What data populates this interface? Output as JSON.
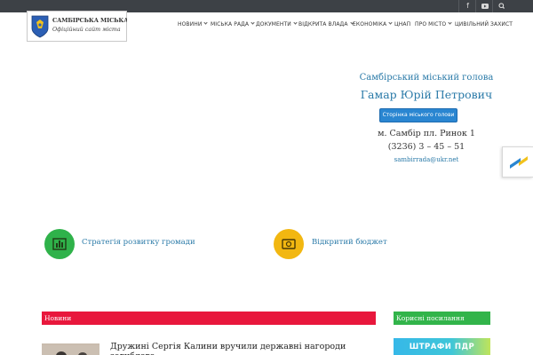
{
  "logo": {
    "title": "САМБІРСЬКА МІСЬКА РАДА",
    "subtitle": "Офіційний сайт міста",
    "crest_color": "#2c5fb4"
  },
  "social": [
    {
      "icon": "facebook-icon",
      "glyph": "f"
    },
    {
      "icon": "youtube-icon",
      "glyph": "▶"
    },
    {
      "icon": "search-icon",
      "glyph": "⌕"
    }
  ],
  "nav": [
    {
      "label": "НОВИНИ",
      "has_dropdown": true
    },
    {
      "label": "МІСЬКА РАДА",
      "has_dropdown": true
    },
    {
      "label": "ДОКУМЕНТИ",
      "has_dropdown": true
    },
    {
      "label": "ВІДКРИТА ВЛАДА",
      "has_dropdown": true
    },
    {
      "label": "ЕКОНОМІКА",
      "has_dropdown": true
    },
    {
      "label": "ЦНАП",
      "has_dropdown": false
    },
    {
      "label": "ПРО МІСТО",
      "has_dropdown": true
    },
    {
      "label": "ЦИВІЛЬНИЙ ЗАХИСТ",
      "has_dropdown": false
    }
  ],
  "mayor": {
    "title": "Самбірський міський голова",
    "name": "Гамар Юрій Петрович",
    "button": "Сторінка міського голови",
    "address": "м. Самбір пл. Ринок 1",
    "phone": "(3236) 3 – 45 – 51",
    "email": "sambirrada@ukr.net"
  },
  "features": [
    {
      "label": "Стратегія розвитку громади",
      "icon": "strategy-chart-icon",
      "color": "#2fb24a"
    },
    {
      "label": "Відкритий бюджет",
      "icon": "money-icon",
      "color": "#f2b711"
    }
  ],
  "news": {
    "header": "Новини",
    "header_color": "#e8173c",
    "items": [
      {
        "title": "Дружині Сергія Калини вручили державні нагороди загиблого"
      }
    ]
  },
  "links": {
    "header": "Корисні посилання",
    "header_color": "#32b44a",
    "banner": "ШТРАФИ ПДР"
  }
}
